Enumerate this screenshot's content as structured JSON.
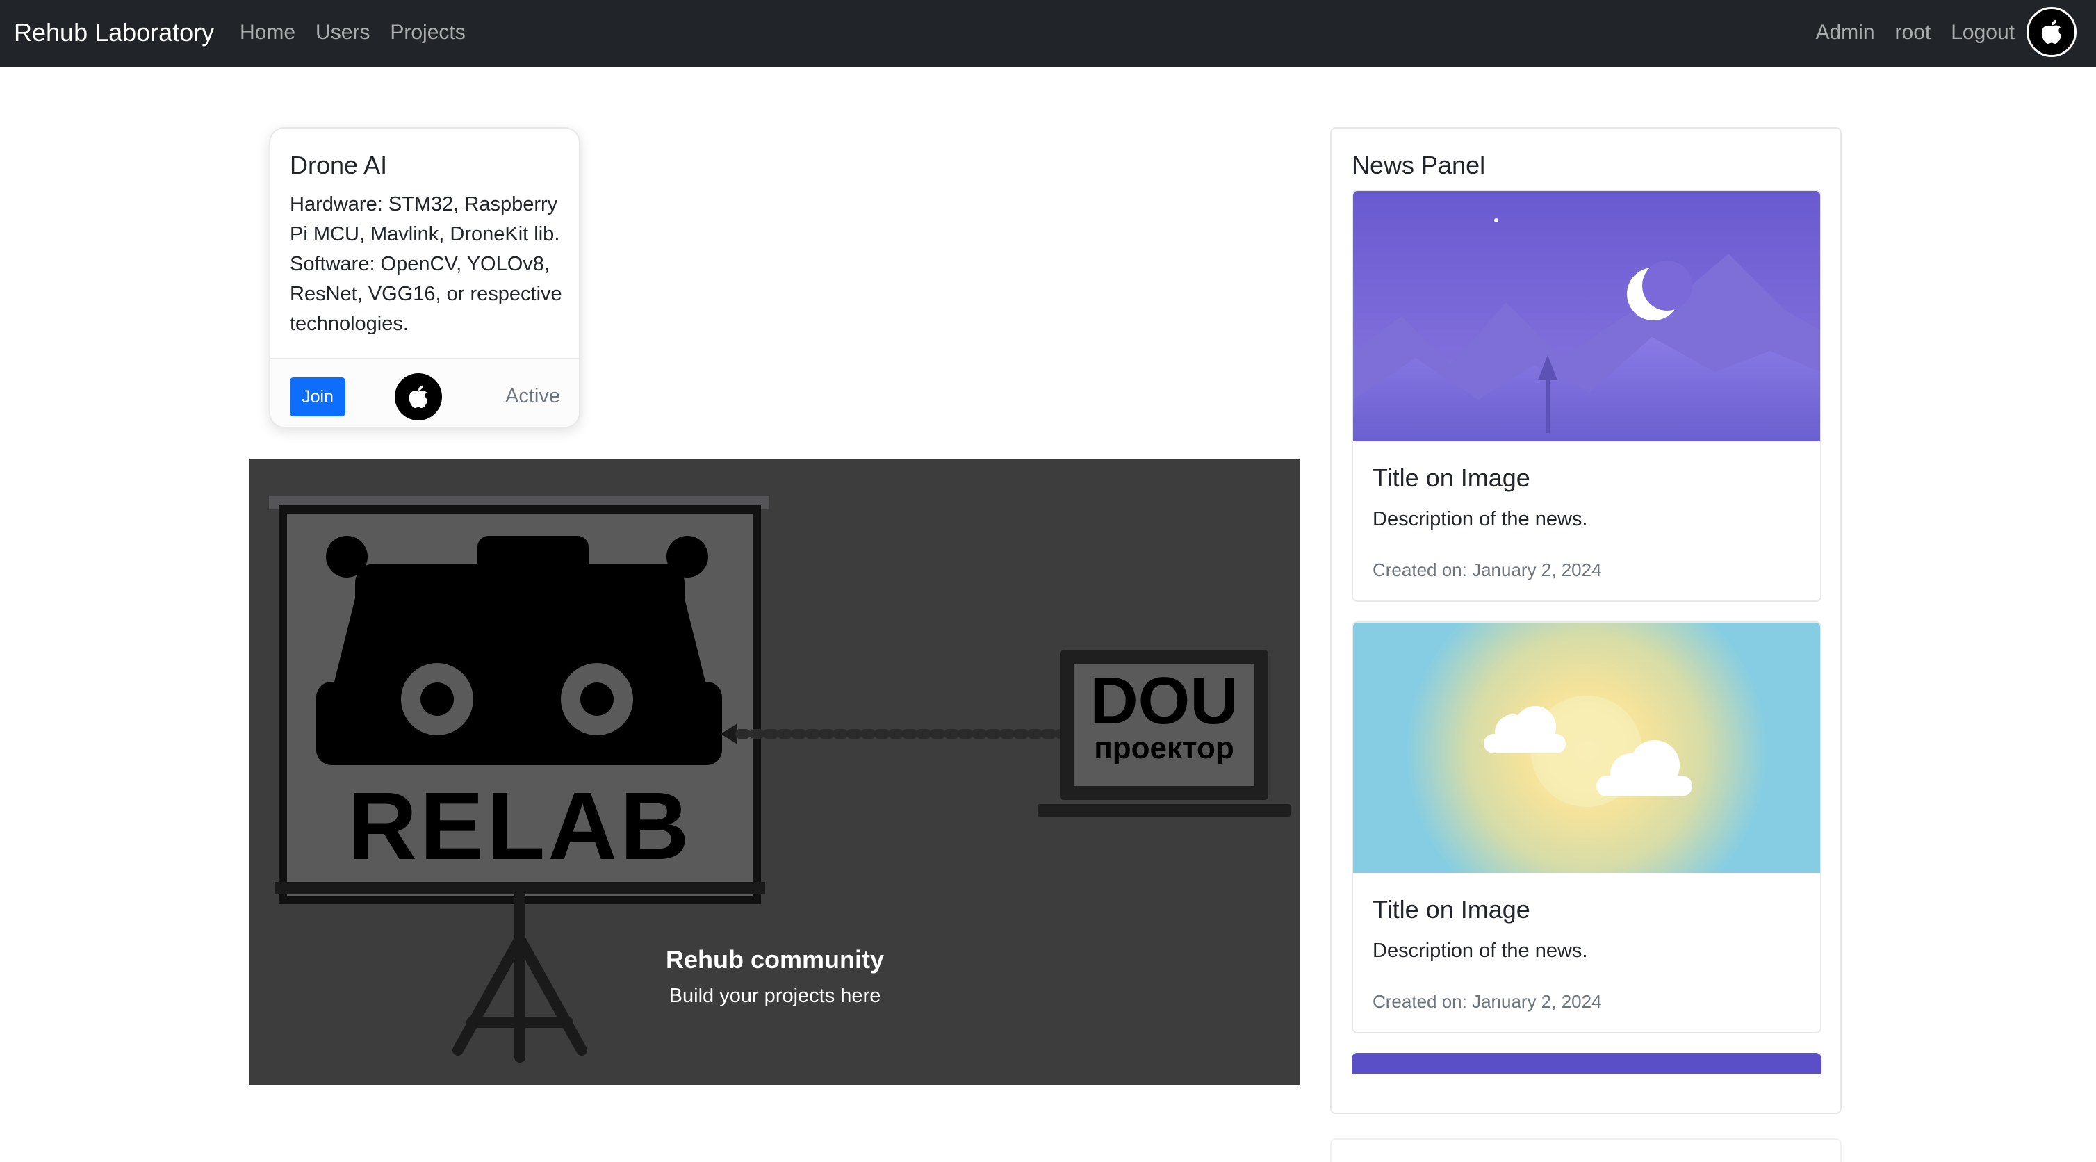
{
  "navbar": {
    "brand": "Rehub Laboratory",
    "links": [
      "Home",
      "Users",
      "Projects"
    ],
    "right_links": [
      "Admin",
      "root",
      "Logout"
    ],
    "avatar_icon": "apple-icon"
  },
  "project_card": {
    "title": "Drone AI",
    "description": "Hardware: STM32, Raspberry Pi MCU, Mavlink, DroneKit lib. Software: OpenCV, YOLOv8, ResNet, VGG16, or respective technologies.",
    "join_label": "Join",
    "avatar_icon": "apple-icon",
    "status": "Active"
  },
  "hero": {
    "logo_text": "RELAB",
    "laptop_line1": "DOU",
    "laptop_line2": "проектор",
    "title": "Rehub community",
    "subtitle": "Build your projects here"
  },
  "news_panel": {
    "title": "News Panel",
    "items": [
      {
        "image_icon": "night-mountains-illustration",
        "title": "Title on Image",
        "description": "Description of the news.",
        "created": "Created on: January 2, 2024"
      },
      {
        "image_icon": "sun-clouds-illustration",
        "title": "Title on Image",
        "description": "Description of the news.",
        "created": "Created on: January 2, 2024"
      }
    ]
  },
  "colors": {
    "navbar_bg": "#212529",
    "primary": "#0d6efd",
    "hero_bg": "#3d3d3e",
    "night_sky": "#7b68d8",
    "day_sky": "#86cde3"
  }
}
